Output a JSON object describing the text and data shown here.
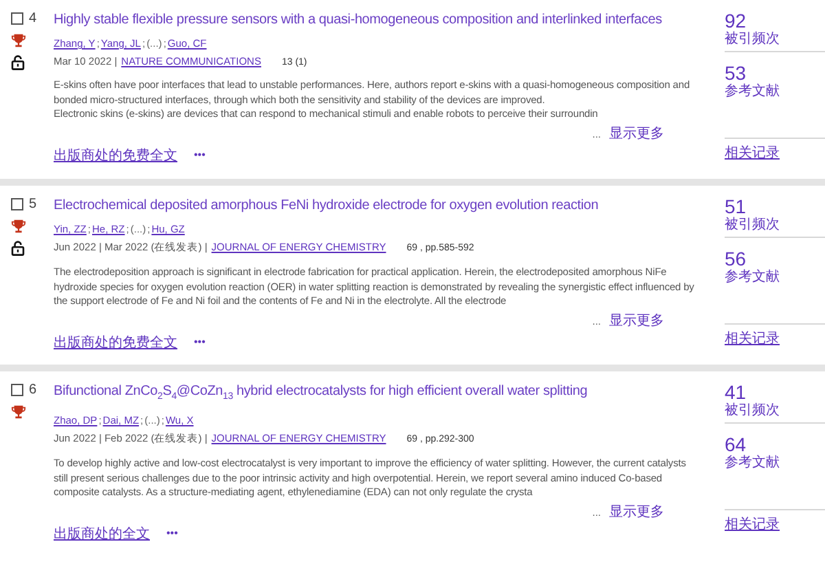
{
  "records": [
    {
      "number": "4",
      "checked": false,
      "highly_cited": true,
      "open_access": true,
      "title": "Highly stable flexible pressure sensors with a quasi-homogeneous composition and interlinked interfaces",
      "authors": [
        {
          "text": "Zhang, Y",
          "kind": "link"
        },
        {
          "text": ";",
          "kind": "sep"
        },
        {
          "text": "Yang, JL",
          "kind": "link"
        },
        {
          "text": ";",
          "kind": "sep"
        },
        {
          "text": "(...)",
          "kind": "plain"
        },
        {
          "text": ";",
          "kind": "sep"
        },
        {
          "text": "Guo, CF",
          "kind": "link"
        }
      ],
      "date": "Mar 10 2022 |",
      "journal": "NATURE COMMUNICATIONS",
      "volume": "13 (1)",
      "abstract": "E-skins often have poor interfaces that lead to unstable performances. Here, authors report e-skins with a quasi-homogeneous composition and bonded micro-structured interfaces, through which both the sensitivity and stability of the devices are improved.\nElectronic skins (e-skins) are devices that can respond to mechanical stimuli and enable robots to perceive their surroundin",
      "ellipsis": "...",
      "show_more": "显示更多",
      "full_text": "出版商处的免费全文",
      "more": "•••",
      "cited_count": "92",
      "cited_label": "被引频次",
      "ref_count": "53",
      "ref_label": "参考文献",
      "related": "相关记录"
    },
    {
      "number": "5",
      "checked": false,
      "highly_cited": true,
      "open_access": true,
      "title": "Electrochemical deposited amorphous FeNi hydroxide electrode for oxygen evolution reaction",
      "authors": [
        {
          "text": "Yin, ZZ",
          "kind": "link"
        },
        {
          "text": ";",
          "kind": "sep"
        },
        {
          "text": "He, RZ",
          "kind": "link"
        },
        {
          "text": ";",
          "kind": "sep"
        },
        {
          "text": "(...)",
          "kind": "plain"
        },
        {
          "text": ";",
          "kind": "sep"
        },
        {
          "text": "Hu, GZ",
          "kind": "link"
        }
      ],
      "date": "Jun 2022 | Mar 2022 (在线发表) |",
      "journal": "JOURNAL OF ENERGY CHEMISTRY",
      "volume": "69 , pp.585-592",
      "abstract": "The electrodeposition approach is significant in electrode fabrication for practical application. Herein, the electrodeposited amorphous NiFe hydroxide species for oxygen evolution reaction (OER) in water splitting reaction is demonstrated by revealing the synergistic effect influenced by the support electrode of Fe and Ni foil and the contents of Fe and Ni in the electrolyte. All the electrode",
      "ellipsis": "...",
      "show_more": "显示更多",
      "full_text": "出版商处的免费全文",
      "more": "•••",
      "cited_count": "51",
      "cited_label": "被引频次",
      "ref_count": "56",
      "ref_label": "参考文献",
      "related": "相关记录"
    },
    {
      "number": "6",
      "checked": false,
      "highly_cited": true,
      "open_access": false,
      "title": "Bifunctional ZnCo$_{2}$S$_{4}$@CoZn$_{13}$ hybrid electrocatalysts for high efficient overall water splitting",
      "authors": [
        {
          "text": "Zhao, DP",
          "kind": "link"
        },
        {
          "text": ";",
          "kind": "sep"
        },
        {
          "text": "Dai, MZ",
          "kind": "link"
        },
        {
          "text": ";",
          "kind": "sep"
        },
        {
          "text": "(...)",
          "kind": "plain"
        },
        {
          "text": ";",
          "kind": "sep"
        },
        {
          "text": "Wu, X",
          "kind": "link"
        }
      ],
      "date": "Jun 2022 | Feb 2022 (在线发表) |",
      "journal": "JOURNAL OF ENERGY CHEMISTRY",
      "volume": "69 , pp.292-300",
      "abstract": "To develop highly active and low-cost electrocatalyst is very important to improve the efficiency of water splitting. However, the current catalysts still present serious challenges due to the poor intrinsic activity and high overpotential. Herein, we report several amino induced Co-based composite catalysts. As a structure-mediating agent, ethylenediamine (EDA) can not only regulate the crysta",
      "ellipsis": "...",
      "show_more": "显示更多",
      "full_text": "出版商处的全文",
      "more": "•••",
      "cited_count": "41",
      "cited_label": "被引频次",
      "ref_count": "64",
      "ref_label": "参考文献",
      "related": "相关记录"
    }
  ]
}
